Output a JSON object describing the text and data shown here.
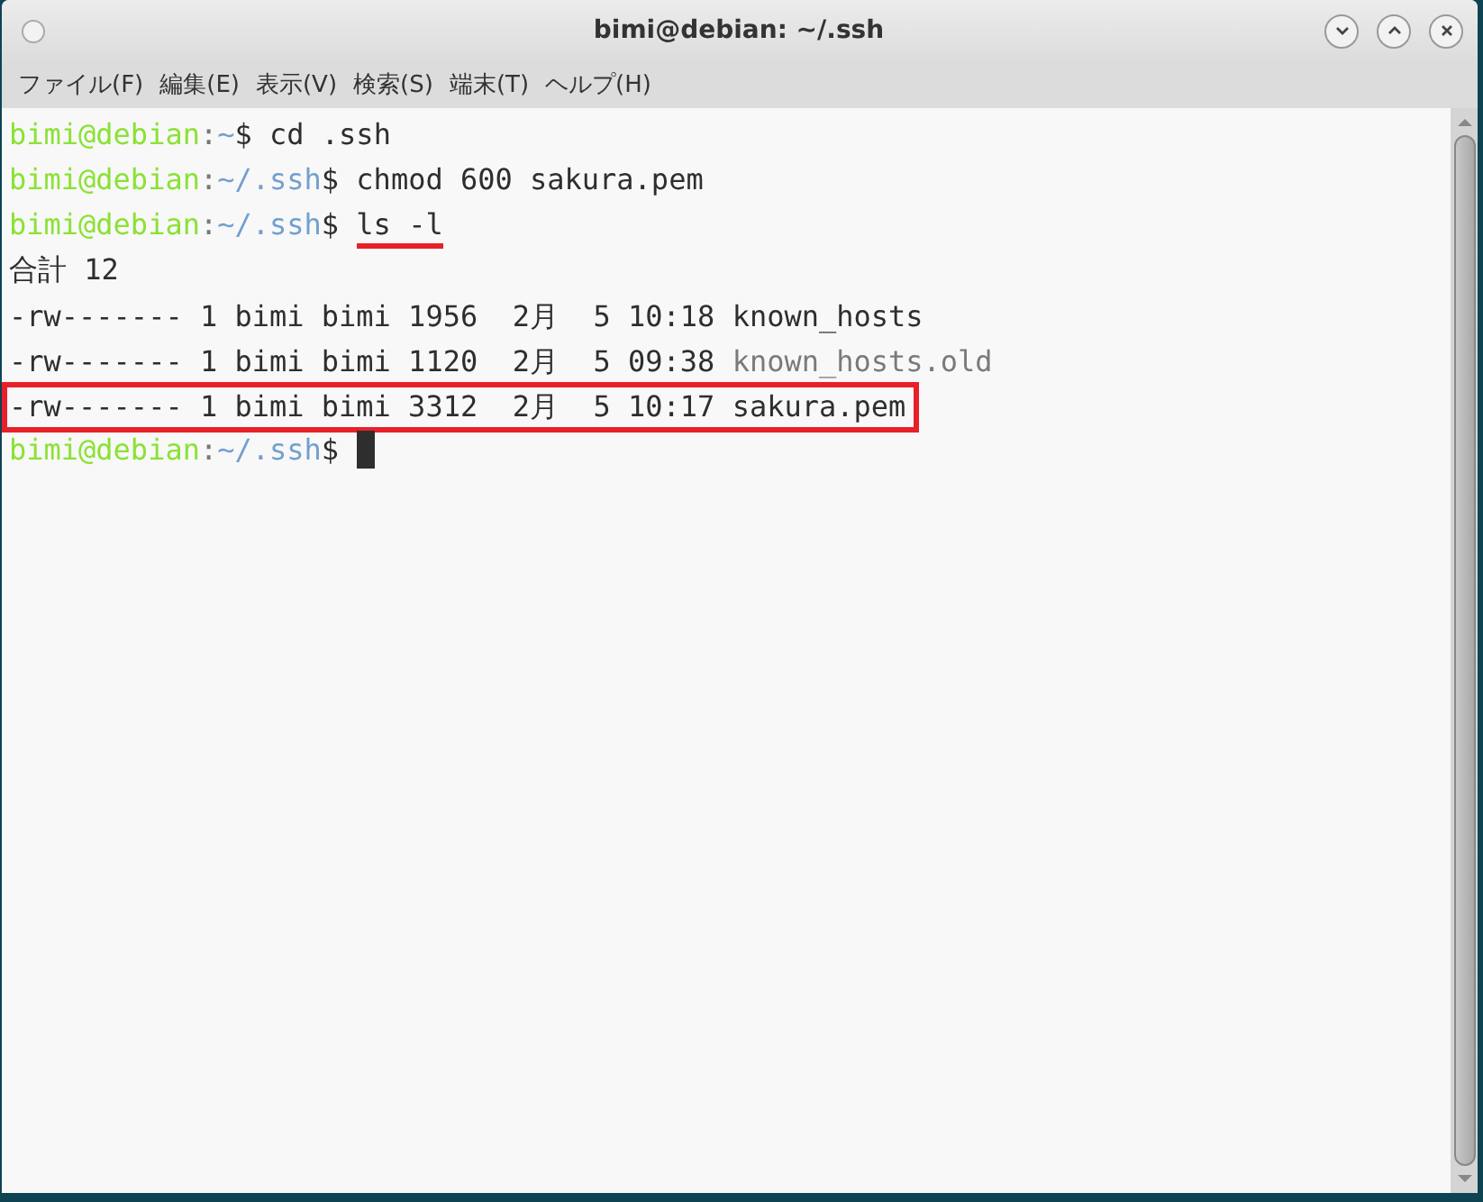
{
  "window": {
    "title": "bimi@debian: ~/.ssh"
  },
  "menu": [
    "ファイル(F)",
    "編集(E)",
    "表示(V)",
    "検索(S)",
    "端末(T)",
    "ヘルプ(H)"
  ],
  "terminal": {
    "lines": [
      {
        "kind": "prompt",
        "user": "bimi@debian",
        "sep": ":",
        "path": "~",
        "dollar": "$",
        "command": "cd .ssh",
        "underlined": false
      },
      {
        "kind": "prompt",
        "user": "bimi@debian",
        "sep": ":",
        "path": "~/.ssh",
        "dollar": "$",
        "command": "chmod 600 sakura.pem",
        "underlined": false
      },
      {
        "kind": "prompt",
        "user": "bimi@debian",
        "sep": ":",
        "path": "~/.ssh",
        "dollar": "$",
        "command": "ls -l",
        "underlined": true
      },
      {
        "kind": "text",
        "text": "合計 12"
      },
      {
        "kind": "output",
        "text": "-rw------- 1 bimi bimi 1956  2月  5 10:18",
        "name": "known_hosts",
        "dimmed": false,
        "boxed": false
      },
      {
        "kind": "output",
        "text": "-rw------- 1 bimi bimi 1120  2月  5 09:38",
        "name": "known_hosts.old",
        "dimmed": true,
        "boxed": false
      },
      {
        "kind": "output",
        "text": "-rw------- 1 bimi bimi 3312  2月  5 10:17",
        "name": "sakura.pem",
        "dimmed": false,
        "boxed": true
      },
      {
        "kind": "prompt",
        "user": "bimi@debian",
        "sep": ":",
        "path": "~/.ssh",
        "dollar": "$",
        "cursor": true
      }
    ]
  }
}
